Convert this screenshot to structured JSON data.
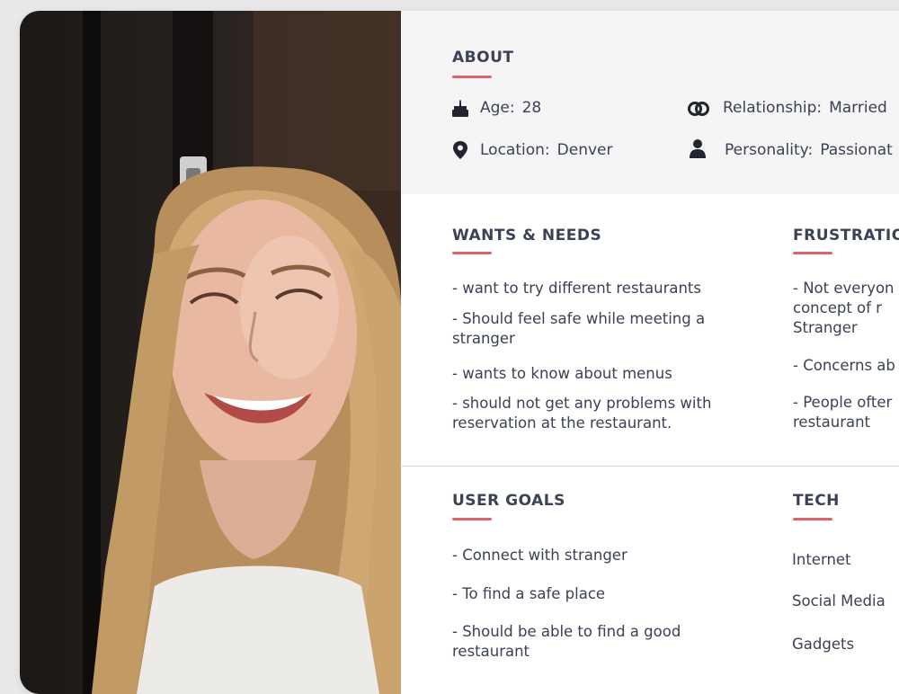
{
  "about": {
    "title": "ABOUT",
    "age_label": "Age:",
    "age_value": "28",
    "relationship_label": "Relationship:",
    "relationship_value": "Married",
    "location_label": "Location:",
    "location_value": "Denver",
    "personality_label": "Personality:",
    "personality_value": "Passionat"
  },
  "wants": {
    "title": "WANTS & NEEDS",
    "items": [
      "- want to try different restaurants",
      "- Should feel safe while meeting a stranger",
      "- wants to know about menus",
      "- should not get any problems with reservation at the restaurant."
    ]
  },
  "frustrations": {
    "title": "FRUSTRATION",
    "items": [
      "- Not everyon concept of r Stranger",
      "- Concerns ab",
      "- People ofter restaurant"
    ]
  },
  "goals": {
    "title": "USER GOALS",
    "items": [
      "- Connect with stranger",
      "- To find a safe place",
      "- Should be able to find a good restaurant"
    ]
  },
  "tech": {
    "title": "TECH",
    "items": [
      "Internet",
      "Social Media",
      "Gadgets"
    ]
  },
  "colors": {
    "accent": "#e0636b",
    "text": "#3b4256"
  }
}
